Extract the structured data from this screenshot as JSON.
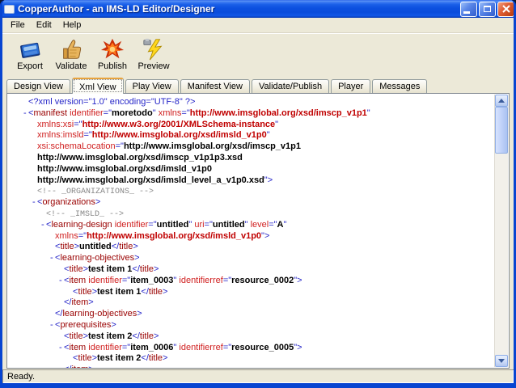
{
  "window": {
    "title": "CopperAuthor - an IMS-LD Editor/Designer",
    "controls": [
      "minimize",
      "maximize",
      "close"
    ]
  },
  "menu": {
    "items": [
      "File",
      "Edit",
      "Help"
    ]
  },
  "toolbar": {
    "buttons": [
      {
        "label": "Export",
        "icon": "export-book-icon"
      },
      {
        "label": "Validate",
        "icon": "validate-hand-icon"
      },
      {
        "label": "Publish",
        "icon": "publish-burst-icon"
      },
      {
        "label": "Preview",
        "icon": "preview-lightning-icon"
      }
    ]
  },
  "tabs": {
    "items": [
      "Design View",
      "Xml View",
      "Play View",
      "Manifest View",
      "Validate/Publish",
      "Player",
      "Messages"
    ],
    "active": "Xml View"
  },
  "statusbar": {
    "text": "Ready."
  },
  "colors": {
    "titlebar_blue": "#0a4cdb",
    "frame_blue": "#0845d1",
    "chrome_bg": "#ece9d8",
    "xml_punctuation": "#2525c8",
    "xml_prolog": "#2525c8",
    "xml_element": "#990000",
    "xml_attribute": "#d02020",
    "xml_value": "#000000",
    "xml_namespace_url": "#c00000",
    "xml_comment": "#888888"
  },
  "xml": {
    "marker_char": "-",
    "lines": [
      {
        "level": 0,
        "marker": false,
        "parts": [
          [
            "x",
            "<?xml version=\"1.0\" encoding=\"UTF-8\" ?>"
          ]
        ]
      },
      {
        "level": 0,
        "marker": true,
        "parts": [
          [
            "p",
            "<"
          ],
          [
            "e",
            "manifest"
          ],
          [
            "a",
            " identifier"
          ],
          [
            "p",
            "=\""
          ],
          [
            "v",
            "moretodo"
          ],
          [
            "p",
            "\""
          ],
          [
            "a",
            " xmlns"
          ],
          [
            "p",
            "=\""
          ],
          [
            "u",
            "http://www.imsglobal.org/xsd/imscp_v1p1"
          ],
          [
            "p",
            "\""
          ]
        ]
      },
      {
        "level": 1,
        "marker": false,
        "parts": [
          [
            "a",
            "xmlns:xsi"
          ],
          [
            "p",
            "=\""
          ],
          [
            "u",
            "http://www.w3.org/2001/XMLSchema-instance"
          ],
          [
            "p",
            "\""
          ]
        ]
      },
      {
        "level": 1,
        "marker": false,
        "parts": [
          [
            "a",
            "xmlns:imsld"
          ],
          [
            "p",
            "=\""
          ],
          [
            "u",
            "http://www.imsglobal.org/xsd/imsld_v1p0"
          ],
          [
            "p",
            "\""
          ]
        ]
      },
      {
        "level": 1,
        "marker": false,
        "parts": [
          [
            "a",
            "xsi:schemaLocation"
          ],
          [
            "p",
            "=\""
          ],
          [
            "v",
            "http://www.imsglobal.org/xsd/imscp_v1p1"
          ]
        ]
      },
      {
        "level": 1,
        "marker": false,
        "parts": [
          [
            "v",
            "http://www.imsglobal.org/xsd/imscp_v1p1p3.xsd"
          ]
        ]
      },
      {
        "level": 1,
        "marker": false,
        "parts": [
          [
            "v",
            "http://www.imsglobal.org/xsd/imsld_v1p0"
          ]
        ]
      },
      {
        "level": 1,
        "marker": false,
        "parts": [
          [
            "v",
            "http://www.imsglobal.org/xsd/imsld_level_a_v1p0.xsd"
          ],
          [
            "p",
            "\">"
          ]
        ]
      },
      {
        "level": 1,
        "marker": false,
        "parts": [
          [
            "m",
            "<!--  _ORGANIZATIONS_  -->"
          ]
        ]
      },
      {
        "level": 1,
        "marker": true,
        "parts": [
          [
            "p",
            "<"
          ],
          [
            "e",
            "organizations"
          ],
          [
            "p",
            ">"
          ]
        ]
      },
      {
        "level": 2,
        "marker": false,
        "parts": [
          [
            "m",
            "<!--  _IMSLD_  -->"
          ]
        ]
      },
      {
        "level": 2,
        "marker": true,
        "parts": [
          [
            "p",
            "<"
          ],
          [
            "e",
            "learning-design"
          ],
          [
            "a",
            " identifier"
          ],
          [
            "p",
            "=\""
          ],
          [
            "v",
            "untitled"
          ],
          [
            "p",
            "\""
          ],
          [
            "a",
            " uri"
          ],
          [
            "p",
            "=\""
          ],
          [
            "v",
            "untitled"
          ],
          [
            "p",
            "\""
          ],
          [
            "a",
            " level"
          ],
          [
            "p",
            "=\""
          ],
          [
            "v",
            "A"
          ],
          [
            "p",
            "\""
          ]
        ]
      },
      {
        "level": 3,
        "marker": false,
        "parts": [
          [
            "a",
            "xmlns"
          ],
          [
            "p",
            "=\""
          ],
          [
            "u",
            "http://www.imsglobal.org/xsd/imsld_v1p0"
          ],
          [
            "p",
            "\">"
          ]
        ]
      },
      {
        "level": 3,
        "marker": false,
        "parts": [
          [
            "p",
            "<"
          ],
          [
            "e",
            "title"
          ],
          [
            "p",
            ">"
          ],
          [
            "t",
            "untitled"
          ],
          [
            "p",
            "</"
          ],
          [
            "e",
            "title"
          ],
          [
            "p",
            ">"
          ]
        ]
      },
      {
        "level": 3,
        "marker": true,
        "parts": [
          [
            "p",
            "<"
          ],
          [
            "e",
            "learning-objectives"
          ],
          [
            "p",
            ">"
          ]
        ]
      },
      {
        "level": 4,
        "marker": false,
        "parts": [
          [
            "p",
            "<"
          ],
          [
            "e",
            "title"
          ],
          [
            "p",
            ">"
          ],
          [
            "t",
            "test item 1"
          ],
          [
            "p",
            "</"
          ],
          [
            "e",
            "title"
          ],
          [
            "p",
            ">"
          ]
        ]
      },
      {
        "level": 4,
        "marker": true,
        "parts": [
          [
            "p",
            "<"
          ],
          [
            "e",
            "item"
          ],
          [
            "a",
            " identifier"
          ],
          [
            "p",
            "=\""
          ],
          [
            "v",
            "item_0003"
          ],
          [
            "p",
            "\""
          ],
          [
            "a",
            " identifierref"
          ],
          [
            "p",
            "=\""
          ],
          [
            "v",
            "resource_0002"
          ],
          [
            "p",
            "\">"
          ]
        ]
      },
      {
        "level": 5,
        "marker": false,
        "parts": [
          [
            "p",
            "<"
          ],
          [
            "e",
            "title"
          ],
          [
            "p",
            ">"
          ],
          [
            "t",
            "test item 1"
          ],
          [
            "p",
            "</"
          ],
          [
            "e",
            "title"
          ],
          [
            "p",
            ">"
          ]
        ]
      },
      {
        "level": 4,
        "marker": false,
        "parts": [
          [
            "p",
            "</"
          ],
          [
            "e",
            "item"
          ],
          [
            "p",
            ">"
          ]
        ]
      },
      {
        "level": 3,
        "marker": false,
        "parts": [
          [
            "p",
            "</"
          ],
          [
            "e",
            "learning-objectives"
          ],
          [
            "p",
            ">"
          ]
        ]
      },
      {
        "level": 3,
        "marker": true,
        "parts": [
          [
            "p",
            "<"
          ],
          [
            "e",
            "prerequisites"
          ],
          [
            "p",
            ">"
          ]
        ]
      },
      {
        "level": 4,
        "marker": false,
        "parts": [
          [
            "p",
            "<"
          ],
          [
            "e",
            "title"
          ],
          [
            "p",
            ">"
          ],
          [
            "t",
            "test item 2"
          ],
          [
            "p",
            "</"
          ],
          [
            "e",
            "title"
          ],
          [
            "p",
            ">"
          ]
        ]
      },
      {
        "level": 4,
        "marker": true,
        "parts": [
          [
            "p",
            "<"
          ],
          [
            "e",
            "item"
          ],
          [
            "a",
            " identifier"
          ],
          [
            "p",
            "=\""
          ],
          [
            "v",
            "item_0006"
          ],
          [
            "p",
            "\""
          ],
          [
            "a",
            " identifierref"
          ],
          [
            "p",
            "=\""
          ],
          [
            "v",
            "resource_0005"
          ],
          [
            "p",
            "\">"
          ]
        ]
      },
      {
        "level": 5,
        "marker": false,
        "parts": [
          [
            "p",
            "<"
          ],
          [
            "e",
            "title"
          ],
          [
            "p",
            ">"
          ],
          [
            "t",
            "test item 2"
          ],
          [
            "p",
            "</"
          ],
          [
            "e",
            "title"
          ],
          [
            "p",
            ">"
          ]
        ]
      },
      {
        "level": 4,
        "marker": false,
        "parts": [
          [
            "p",
            "</"
          ],
          [
            "e",
            "item"
          ],
          [
            "p",
            ">"
          ]
        ]
      }
    ]
  }
}
